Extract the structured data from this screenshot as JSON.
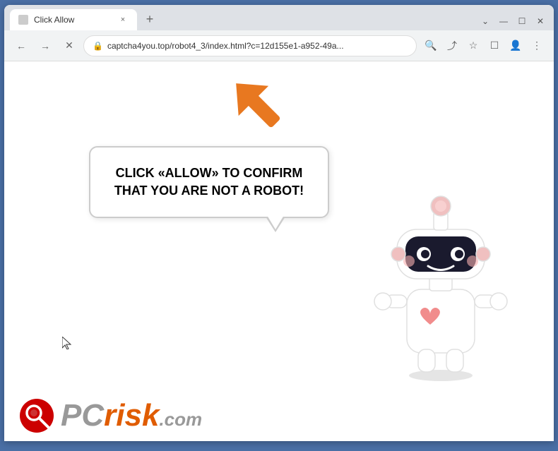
{
  "browser": {
    "tab": {
      "title": "Click Allow",
      "close_label": "×",
      "new_tab_label": "+"
    },
    "window_controls": {
      "minimize": "—",
      "maximize": "☐",
      "close": "✕"
    },
    "toolbar": {
      "back_label": "←",
      "forward_label": "→",
      "reload_label": "✕",
      "address": "captcha4you.top/robot4_3/index.html?c=12d155e1-a952-49a...",
      "search_label": "🔍",
      "share_label": "⤴",
      "bookmark_label": "☆",
      "extensions_label": "☐",
      "profile_label": "👤",
      "menu_label": "⋮"
    },
    "page": {
      "bubble_text": "CLICK «ALLOW» TO CONFIRM THAT YOU ARE NOT A ROBOT!",
      "pcrisk_pc": "PC",
      "pcrisk_risk": "risk",
      "pcrisk_dot": ".",
      "pcrisk_com": "com"
    }
  }
}
